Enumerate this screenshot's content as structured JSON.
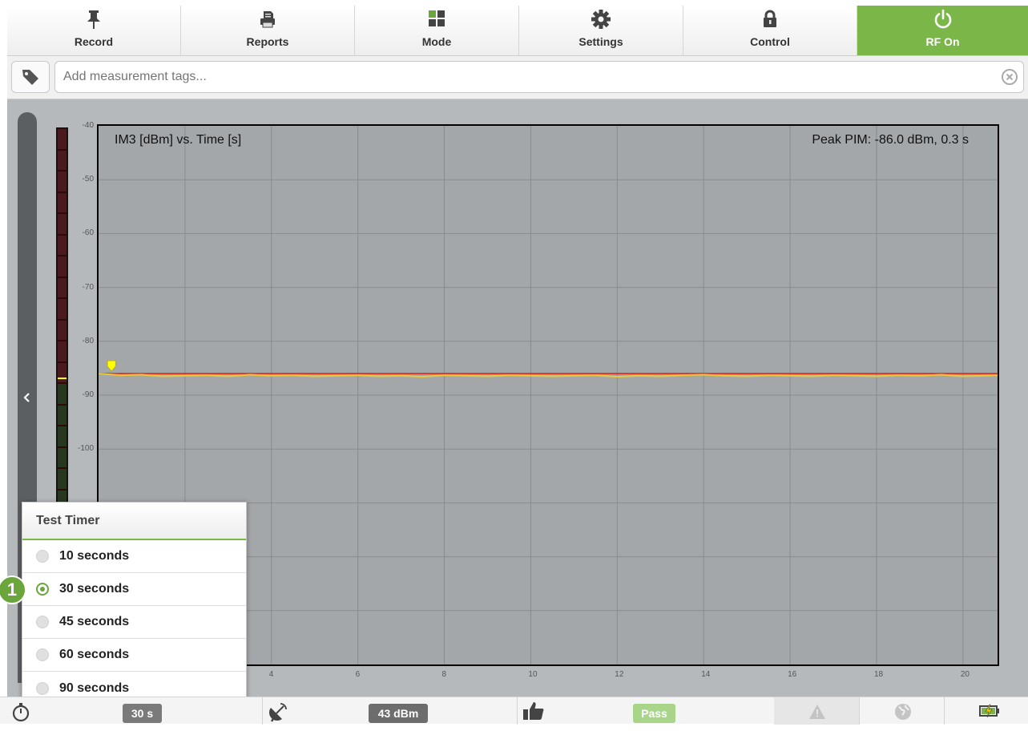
{
  "toolbar": {
    "items": [
      {
        "label": "Record",
        "icon": "pushpin-icon"
      },
      {
        "label": "Reports",
        "icon": "printer-icon"
      },
      {
        "label": "Mode",
        "icon": "grid-icon"
      },
      {
        "label": "Settings",
        "icon": "gear-icon"
      },
      {
        "label": "Control",
        "icon": "lock-icon"
      },
      {
        "label": "RF On",
        "icon": "power-icon",
        "active": true
      }
    ],
    "accent": "#7ab648"
  },
  "tags": {
    "placeholder": "Add measurement tags...",
    "value": "",
    "icon": "tag-icon",
    "clear_icon": "clear-circle-icon"
  },
  "chart_data": {
    "type": "line",
    "title": "IM3 [dBm] vs. Time [s]",
    "annotation": "Peak PIM: -86.0 dBm, 0.3 s",
    "xlim": [
      0,
      20.8
    ],
    "ylim": [
      -140,
      -40
    ],
    "x_ticks": [
      4,
      6,
      8,
      10,
      12,
      14,
      16,
      18,
      20
    ],
    "y_ticks": [
      -40,
      -50,
      -60,
      -70,
      -80,
      -90,
      -100
    ],
    "grid": true,
    "peak_marker": {
      "x": 0.3,
      "y": -86.0
    },
    "series": [
      {
        "name": "",
        "color": "#d23a2b",
        "style": "line",
        "x": [
          0,
          20.8
        ],
        "y": [
          -86.0,
          -86.0
        ]
      },
      {
        "name": "",
        "color": "#e8c83a",
        "style": "line",
        "x": [
          0,
          0.5,
          1,
          1.5,
          2,
          2.5,
          3,
          3.5,
          4,
          4.5,
          5,
          5.5,
          6,
          6.5,
          7,
          7.5,
          8,
          8.5,
          9,
          9.5,
          10,
          10.5,
          11,
          11.5,
          12,
          12.5,
          13,
          13.5,
          14,
          14.5,
          15,
          15.5,
          16,
          16.5,
          17,
          17.5,
          18,
          18.5,
          19,
          19.5,
          20,
          20.5,
          20.8
        ],
        "y": [
          -86.0,
          -86.3,
          -86.2,
          -86.5,
          -86.4,
          -86.3,
          -86.5,
          -86.2,
          -86.4,
          -86.3,
          -86.5,
          -86.4,
          -86.3,
          -86.5,
          -86.4,
          -86.6,
          -86.3,
          -86.4,
          -86.5,
          -86.3,
          -86.4,
          -86.5,
          -86.4,
          -86.3,
          -86.6,
          -86.4,
          -86.5,
          -86.3,
          -86.2,
          -86.4,
          -86.5,
          -86.3,
          -86.4,
          -86.5,
          -86.3,
          -86.4,
          -86.5,
          -86.3,
          -86.4,
          -86.2,
          -86.5,
          -86.4,
          -86.3
        ]
      }
    ]
  },
  "meter": {
    "level": -86.0,
    "min": -140,
    "max": -40
  },
  "timer_popup": {
    "title": "Test Timer",
    "options": [
      "10 seconds",
      "30 seconds",
      "45 seconds",
      "60 seconds",
      "90 seconds"
    ],
    "selected": "30 seconds"
  },
  "callout": {
    "number": "1",
    "color": "#6aa63b"
  },
  "status": {
    "timer_value": "30 s",
    "power_value": "43 dBm",
    "result": "Pass",
    "icons": [
      "stopwatch-icon",
      "antenna-icon",
      "thumbs-up-icon",
      "warning-icon",
      "globe-icon",
      "battery-charging-icon"
    ],
    "colors": {
      "timer_pill": "#7a7a7a",
      "power_pill": "#6d6d6d",
      "pass_pill": "#a9d58a"
    }
  }
}
